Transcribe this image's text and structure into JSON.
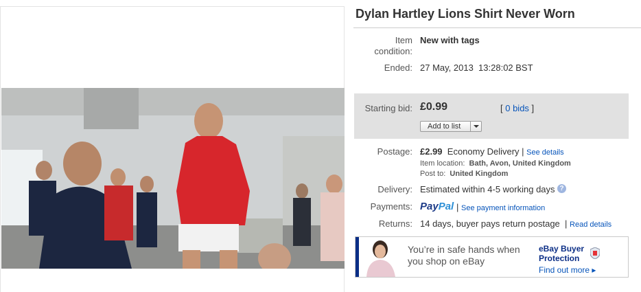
{
  "listing": {
    "title": "Dylan Hartley Lions Shirt Never Worn"
  },
  "details": {
    "condition_label": "Item condition:",
    "condition_value": "New with tags",
    "ended_label": "Ended:",
    "ended_date": "27 May, 2013",
    "ended_time": "13:28:02 BST"
  },
  "bid": {
    "label": "Starting bid:",
    "price": "£0.99",
    "bids_link": "0 bids",
    "add_to_list_label": "Add to list"
  },
  "postage": {
    "label": "Postage:",
    "price": "£2.99",
    "service": "Economy Delivery",
    "details_link": "See details",
    "item_location_label": "Item location:",
    "item_location": "Bath, Avon, United Kingdom",
    "post_to_label": "Post to:",
    "post_to": "United Kingdom"
  },
  "delivery": {
    "label": "Delivery:",
    "value": "Estimated within 4-5 working days"
  },
  "payments": {
    "label": "Payments:",
    "paypal_part1": "Pay",
    "paypal_part2": "Pal",
    "info_link": "See payment information"
  },
  "returns": {
    "label": "Returns:",
    "value": "14 days, buyer pays return postage",
    "details_link": "Read details"
  },
  "banner": {
    "message": "You’re in safe hands when you shop on eBay",
    "protection_line1": "eBay Buyer",
    "protection_line2": "Protection",
    "find_out_more": "Find out more ▸"
  },
  "colors": {
    "link": "#0654ba",
    "bid_box": "#e1e1e1",
    "banner_accent": "#0b2e86",
    "jersey_red": "#d7262c"
  }
}
